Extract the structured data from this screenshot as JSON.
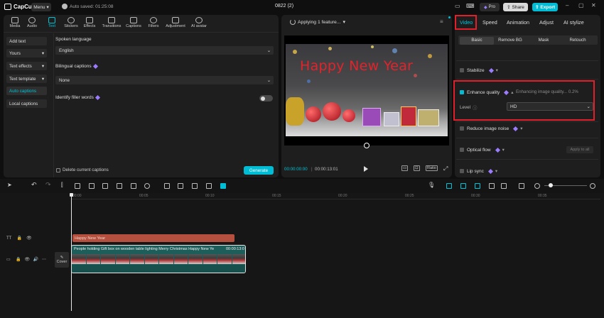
{
  "app": {
    "logo_text": "CapCut",
    "menu_label": "Menu",
    "autosave_text": "Auto saved: 01:25:08",
    "project_title": "0822 (2)",
    "pro_label": "Pro",
    "share_label": "Share",
    "export_label": "Export"
  },
  "left_tabs": [
    {
      "label": "Media",
      "icon": "media-icon"
    },
    {
      "label": "Audio",
      "icon": "audio-icon"
    },
    {
      "label": "Text",
      "icon": "text-icon",
      "active": true
    },
    {
      "label": "Stickers",
      "icon": "stickers-icon"
    },
    {
      "label": "Effects",
      "icon": "effects-icon"
    },
    {
      "label": "Transitions",
      "icon": "transitions-icon"
    },
    {
      "label": "Captions",
      "icon": "captions-icon"
    },
    {
      "label": "Filters",
      "icon": "filters-icon"
    },
    {
      "label": "Adjustment",
      "icon": "adjustment-icon"
    },
    {
      "label": "AI avatar",
      "icon": "ai-avatar-icon"
    }
  ],
  "text_sidebar": [
    {
      "label": "Add text"
    },
    {
      "label": "Yours"
    },
    {
      "label": "Text effects"
    },
    {
      "label": "Text template"
    },
    {
      "label": "Auto captions",
      "active": true
    },
    {
      "label": "Local captions"
    }
  ],
  "captions": {
    "spoken_language_label": "Spoken language",
    "spoken_language_value": "English",
    "bilingual_label": "Bilingual captions",
    "bilingual_value": "None",
    "filler_label": "Identify filler words",
    "delete_label": "Delete current captions",
    "generate_label": "Generate"
  },
  "preview": {
    "status": "Applying 1 feature...",
    "overlay_text": "Happy New Year",
    "current_time": "00:00:00:00",
    "total_time": "00:00:13:01",
    "ratio_label": "Ratio"
  },
  "right_tabs": [
    {
      "label": "Video",
      "active": true
    },
    {
      "label": "Speed"
    },
    {
      "label": "Animation"
    },
    {
      "label": "Adjust"
    },
    {
      "label": "AI stylize"
    }
  ],
  "video_subtabs": [
    {
      "label": "Basic",
      "active": true
    },
    {
      "label": "Remove BG"
    },
    {
      "label": "Mask"
    },
    {
      "label": "Retouch"
    }
  ],
  "video_settings": {
    "stabilize_label": "Stabilize",
    "enhance_label": "Enhance quality",
    "enhance_status": "Enhancing image quality... 0.2%",
    "level_label": "Level",
    "level_value": "HD",
    "noise_label": "Reduce image noise",
    "optical_label": "Optical flow",
    "apply_all_label": "Apply to all",
    "lip_sync_label": "Lip sync"
  },
  "timeline": {
    "ruler": [
      "00:00",
      "00:05",
      "00:10",
      "00:15",
      "00:20",
      "00:25",
      "00:30",
      "00:35",
      "00:40",
      "00:45",
      "00:50"
    ],
    "text_clip": "Happy New Year",
    "video_clip_name": "People holding Gift box on wooden table lighting Merry Christmas Happy New Ye",
    "video_clip_duration": "00:00:13:0",
    "cover_label": "Cover"
  },
  "colors": {
    "accent": "#00bcd4",
    "highlight_border": "#e0202a",
    "text_clip": "#b4503d",
    "video_clip": "#1d5e5b"
  }
}
